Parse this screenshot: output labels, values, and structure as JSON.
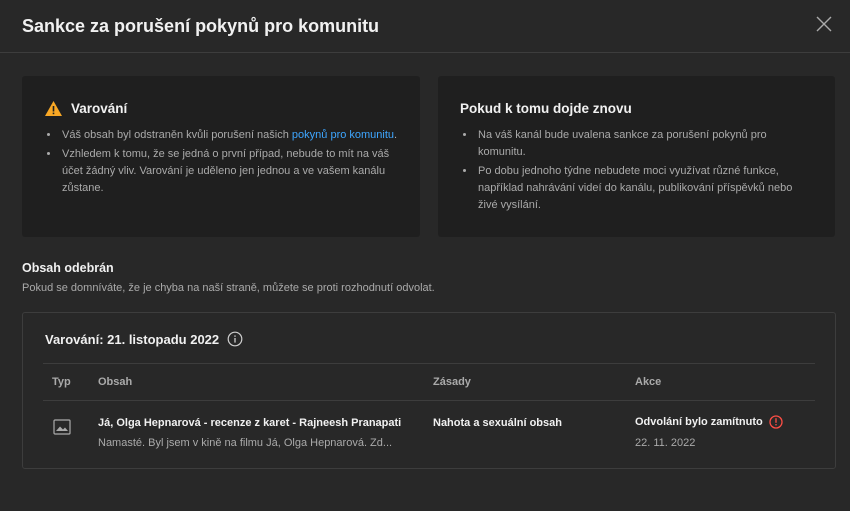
{
  "dialog": {
    "title": "Sankce za porušení pokynů pro komunitu",
    "close_icon": "close-icon"
  },
  "warning_card": {
    "heading": "Varování",
    "icon": "warning-triangle-icon",
    "item1_text": "Váš obsah byl odstraněn kvůli porušení našich ",
    "item1_link": "pokynů pro komunitu",
    "item1_end": ".",
    "item2": "Vzhledem k tomu, že se jedná o první případ, nebude to mít na váš účet žádný vliv. Varování je uděleno jen jednou a ve vašem kanálu zůstane."
  },
  "repeat_card": {
    "heading": "Pokud k tomu dojde znovu",
    "item1": "Na váš kanál bude uvalena sankce za porušení pokynů pro komunitu.",
    "item2": "Po dobu jednoho týdne nebudete moci využívat různé funkce, například nahrávání videí do kanálu, publikování příspěvků nebo živé vysílání."
  },
  "removed": {
    "title": "Obsah odebrán",
    "subtitle": "Pokud se domníváte, že je chyba na naší straně, můžete se proti rozhodnutí odvolat."
  },
  "strike": {
    "heading": "Varování: 21. listopadu 2022",
    "columns": {
      "type": "Typ",
      "content": "Obsah",
      "policy": "Zásady",
      "action": "Akce"
    },
    "row": {
      "type_icon": "image-icon",
      "title": "Já, Olga Hepnarová - recenze z karet - Rajneesh Pranapati",
      "description": "Namasté. Byl jsem v kině na filmu Já, Olga Hepnarová. Zd...",
      "policy": "Nahota a sexuální obsah",
      "action_status": "Odvolání bylo zamítnuto",
      "action_date": "22. 11. 2022"
    }
  },
  "colors": {
    "background": "#282828",
    "card": "#1f1f1f",
    "link": "#3ea6ff",
    "warning": "#f9a825",
    "error": "#ff4e45"
  }
}
